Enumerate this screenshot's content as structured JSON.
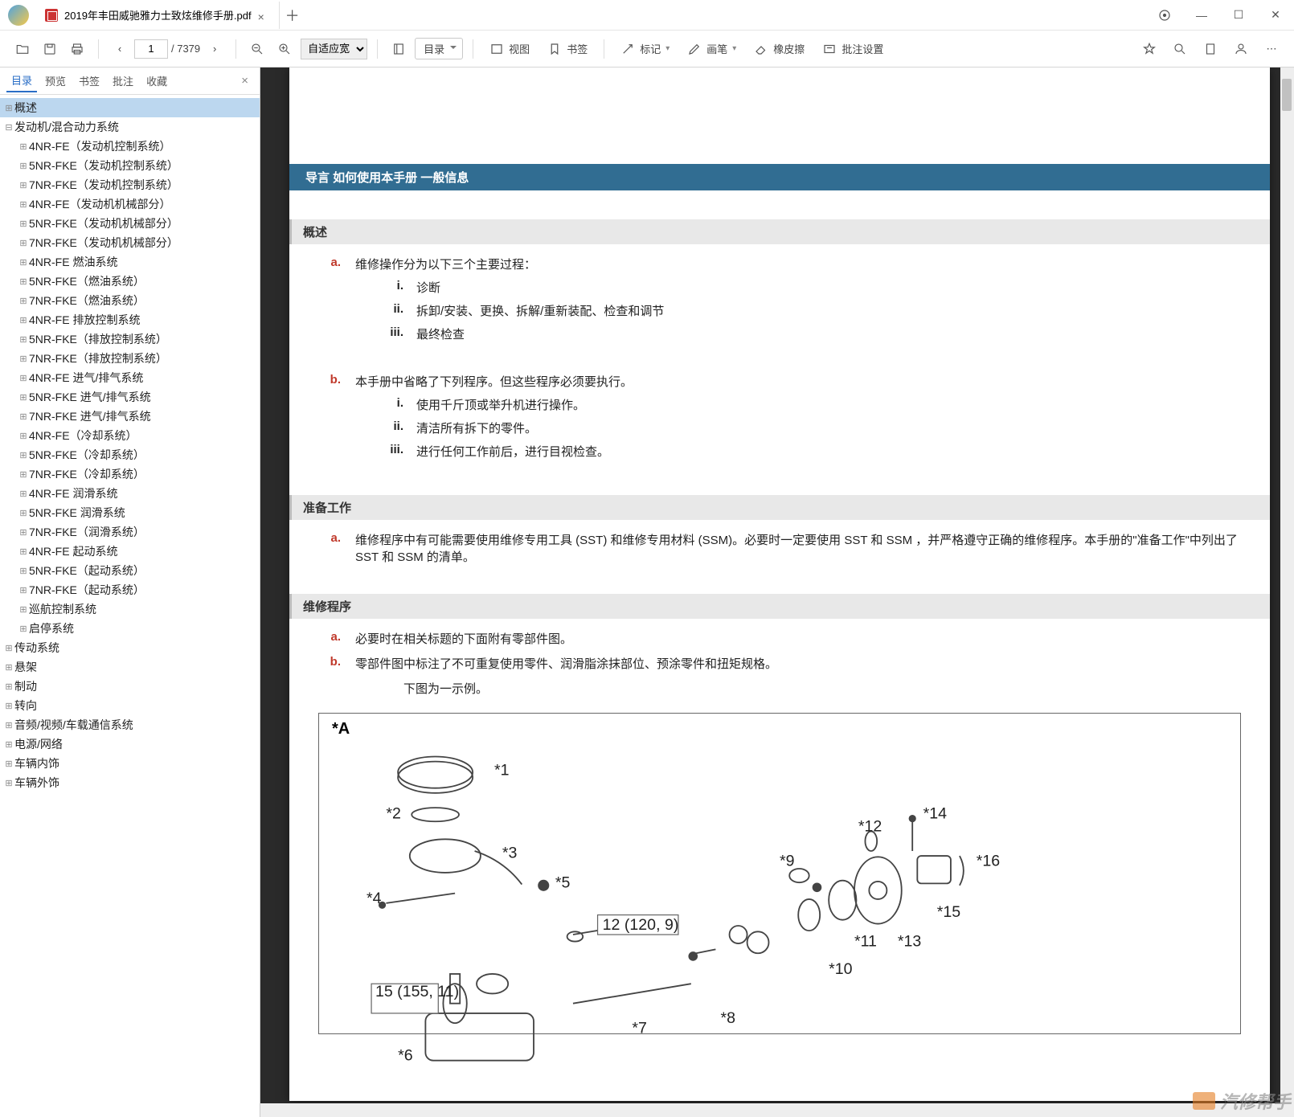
{
  "tab_title": "2019年丰田威驰雅力士致炫维修手册.pdf",
  "page_current": "1",
  "page_total": "/ 7379",
  "zoom_mode": "自适应宽",
  "toolbar": {
    "toc": "目录",
    "view": "视图",
    "bookmark": "书签",
    "mark": "标记",
    "brush": "画笔",
    "eraser": "橡皮擦",
    "batch": "批注设置"
  },
  "sidebar_tabs": [
    "目录",
    "预览",
    "书签",
    "批注",
    "收藏"
  ],
  "tree": {
    "root": [
      {
        "l": "概述",
        "d": 0,
        "sel": true,
        "tw": "+"
      },
      {
        "l": "发动机/混合动力系统",
        "d": 0,
        "tw": "-"
      },
      {
        "l": "4NR-FE（发动机控制系统）",
        "d": 1,
        "tw": "+"
      },
      {
        "l": "5NR-FKE（发动机控制系统）",
        "d": 1,
        "tw": "+"
      },
      {
        "l": "7NR-FKE（发动机控制系统）",
        "d": 1,
        "tw": "+"
      },
      {
        "l": "4NR-FE（发动机机械部分）",
        "d": 1,
        "tw": "+"
      },
      {
        "l": "5NR-FKE（发动机机械部分）",
        "d": 1,
        "tw": "+"
      },
      {
        "l": "7NR-FKE（发动机机械部分）",
        "d": 1,
        "tw": "+"
      },
      {
        "l": "4NR-FE 燃油系统",
        "d": 1,
        "tw": "+"
      },
      {
        "l": "5NR-FKE（燃油系统）",
        "d": 1,
        "tw": "+"
      },
      {
        "l": "7NR-FKE（燃油系统）",
        "d": 1,
        "tw": "+"
      },
      {
        "l": "4NR-FE 排放控制系统",
        "d": 1,
        "tw": "+"
      },
      {
        "l": "5NR-FKE（排放控制系统）",
        "d": 1,
        "tw": "+"
      },
      {
        "l": "7NR-FKE（排放控制系统）",
        "d": 1,
        "tw": "+"
      },
      {
        "l": "4NR-FE 进气/排气系统",
        "d": 1,
        "tw": "+"
      },
      {
        "l": "5NR-FKE 进气/排气系统",
        "d": 1,
        "tw": "+"
      },
      {
        "l": "7NR-FKE 进气/排气系统",
        "d": 1,
        "tw": "+"
      },
      {
        "l": "4NR-FE（冷却系统）",
        "d": 1,
        "tw": "+"
      },
      {
        "l": "5NR-FKE（冷却系统）",
        "d": 1,
        "tw": "+"
      },
      {
        "l": "7NR-FKE（冷却系统）",
        "d": 1,
        "tw": "+"
      },
      {
        "l": "4NR-FE 润滑系统",
        "d": 1,
        "tw": "+"
      },
      {
        "l": "5NR-FKE 润滑系统",
        "d": 1,
        "tw": "+"
      },
      {
        "l": "7NR-FKE（润滑系统）",
        "d": 1,
        "tw": "+"
      },
      {
        "l": "4NR-FE 起动系统",
        "d": 1,
        "tw": "+"
      },
      {
        "l": "5NR-FKE（起动系统）",
        "d": 1,
        "tw": "+"
      },
      {
        "l": "7NR-FKE（起动系统）",
        "d": 1,
        "tw": "+"
      },
      {
        "l": "巡航控制系统",
        "d": 1,
        "tw": "+"
      },
      {
        "l": "启停系统",
        "d": 1,
        "tw": "+"
      },
      {
        "l": "传动系统",
        "d": 0,
        "tw": "+"
      },
      {
        "l": "悬架",
        "d": 0,
        "tw": "+"
      },
      {
        "l": "制动",
        "d": 0,
        "tw": "+"
      },
      {
        "l": "转向",
        "d": 0,
        "tw": "+"
      },
      {
        "l": "音频/视频/车载通信系统",
        "d": 0,
        "tw": "+"
      },
      {
        "l": "电源/网络",
        "d": 0,
        "tw": "+"
      },
      {
        "l": "车辆内饰",
        "d": 0,
        "tw": "+"
      },
      {
        "l": "车辆外饰",
        "d": 0,
        "tw": "+"
      }
    ]
  },
  "doc": {
    "breadcrumb": "导言   如何使用本手册   一般信息",
    "s1": "概述",
    "a_text": "维修操作分为以下三个主要过程：",
    "a_i": "诊断",
    "a_ii": "拆卸/安装、更换、拆解/重新装配、检查和调节",
    "a_iii": "最终检查",
    "b_text": "本手册中省略了下列程序。但这些程序必须要执行。",
    "b_i": "使用千斤顶或举升机进行操作。",
    "b_ii": "清洁所有拆下的零件。",
    "b_iii": "进行任何工作前后，进行目视检查。",
    "s2": "准备工作",
    "prep_a": "维修程序中有可能需要使用维修专用工具 (SST) 和维修专用材料 (SSM)。必要时一定要使用 SST 和 SSM ，并严格遵守正确的维修程序。本手册的\"准备工作\"中列出了 SST 和 SSM 的清单。",
    "s3": "维修程序",
    "proc_a": "必要时在相关标题的下面附有零部件图。",
    "proc_b": "零部件图中标注了不可重复使用零件、润滑脂涂抹部位、预涂零件和扭矩规格。",
    "proc_note": "下图为一示例。",
    "diagram_title": "*A",
    "torque1": "12 (120, 9)",
    "torque2": "15 (155, 11)"
  },
  "watermark": "汽修帮手"
}
